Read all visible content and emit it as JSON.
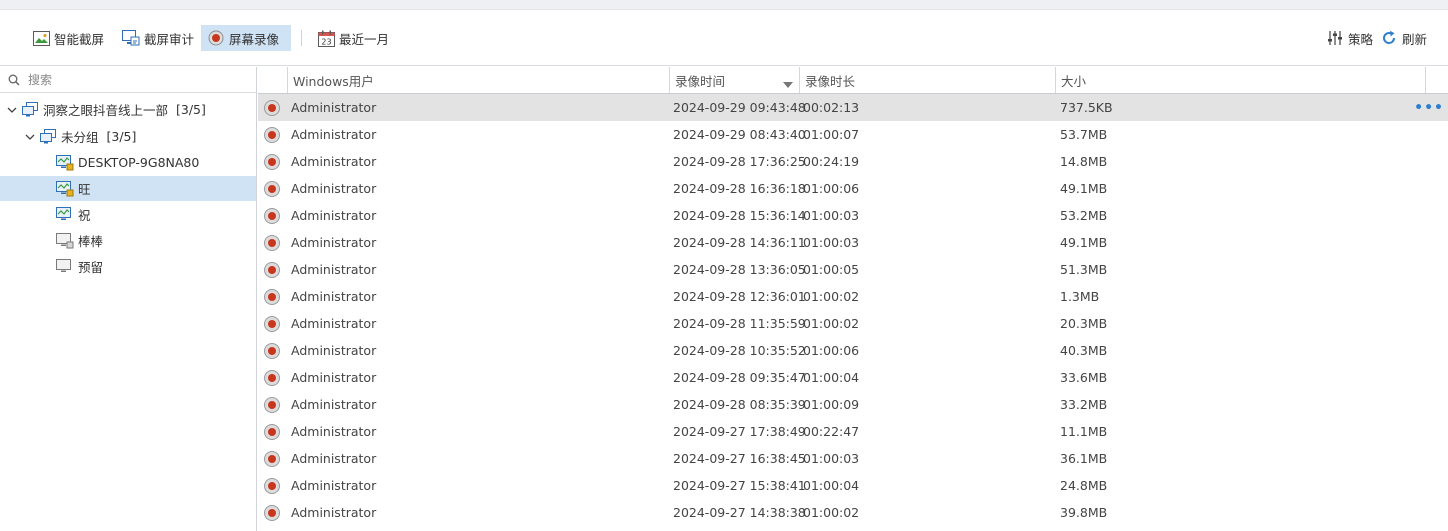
{
  "toolbar": {
    "smart_capture": "智能截屏",
    "capture_audit": "截屏审计",
    "screen_record": "屏幕录像",
    "recent_month": "最近一月",
    "calendar_day": "23",
    "policy": "策略",
    "refresh": "刷新"
  },
  "sidebar": {
    "search_placeholder": "搜索",
    "tree": [
      {
        "label": "洞察之眼抖音线上一部",
        "count": "[3/5]"
      },
      {
        "label": "未分组",
        "count": "[3/5]"
      },
      {
        "label": "DESKTOP-9G8NA80"
      },
      {
        "label": "旺"
      },
      {
        "label": "祝"
      },
      {
        "label": "棒棒"
      },
      {
        "label": "预留"
      }
    ]
  },
  "table": {
    "columns": [
      "Windows用户",
      "录像时间",
      "录像时长",
      "大小"
    ],
    "rows": [
      [
        "Administrator",
        "2024-09-29 09:43:48",
        "00:02:13",
        "737.5KB"
      ],
      [
        "Administrator",
        "2024-09-29 08:43:40",
        "01:00:07",
        "53.7MB"
      ],
      [
        "Administrator",
        "2024-09-28 17:36:25",
        "00:24:19",
        "14.8MB"
      ],
      [
        "Administrator",
        "2024-09-28 16:36:18",
        "01:00:06",
        "49.1MB"
      ],
      [
        "Administrator",
        "2024-09-28 15:36:14",
        "01:00:03",
        "53.2MB"
      ],
      [
        "Administrator",
        "2024-09-28 14:36:11",
        "01:00:03",
        "49.1MB"
      ],
      [
        "Administrator",
        "2024-09-28 13:36:05",
        "01:00:05",
        "51.3MB"
      ],
      [
        "Administrator",
        "2024-09-28 12:36:01",
        "01:00:02",
        "1.3MB"
      ],
      [
        "Administrator",
        "2024-09-28 11:35:59",
        "01:00:02",
        "20.3MB"
      ],
      [
        "Administrator",
        "2024-09-28 10:35:52",
        "01:00:06",
        "40.3MB"
      ],
      [
        "Administrator",
        "2024-09-28 09:35:47",
        "01:00:04",
        "33.6MB"
      ],
      [
        "Administrator",
        "2024-09-28 08:35:39",
        "01:00:09",
        "33.2MB"
      ],
      [
        "Administrator",
        "2024-09-27 17:38:49",
        "00:22:47",
        "11.1MB"
      ],
      [
        "Administrator",
        "2024-09-27 16:38:45",
        "01:00:03",
        "36.1MB"
      ],
      [
        "Administrator",
        "2024-09-27 15:38:41",
        "01:00:04",
        "24.8MB"
      ],
      [
        "Administrator",
        "2024-09-27 14:38:38",
        "01:00:02",
        "39.8MB"
      ]
    ],
    "row_more": "•••"
  },
  "colors": {
    "accent": "#2f7fd0",
    "selection": "#cfe3f5",
    "record_red": "#c8361e"
  }
}
